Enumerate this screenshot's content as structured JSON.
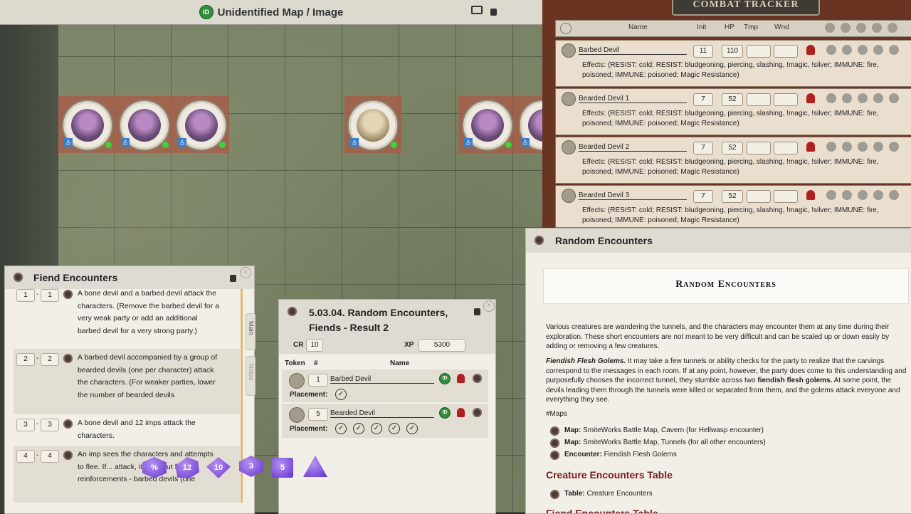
{
  "map": {
    "title": "Unidentified Map / Image",
    "id_badge": "ID"
  },
  "combat_tracker": {
    "title": "COMBAT TRACKER",
    "columns": {
      "name": "Name",
      "init": "Init",
      "hp": "HP",
      "tmp": "Tmp",
      "wnd": "Wnd"
    },
    "rows": [
      {
        "name": "Barbed Devil",
        "init": "11",
        "hp": "110",
        "effects": "Effects: (RESIST: cold; RESIST: bludgeoning, piercing, slashing, !magic, !silver; IMMUNE: fire, poisoned; IMMUNE: poisoned; Magic Resistance)"
      },
      {
        "name": "Bearded Devil 1",
        "init": "7",
        "hp": "52",
        "effects": "Effects: (RESIST: cold; RESIST: bludgeoning, piercing, slashing, !magic, !silver; IMMUNE: fire, poisoned; IMMUNE: poisoned; Magic Resistance)"
      },
      {
        "name": "Bearded Devil 2",
        "init": "7",
        "hp": "52",
        "effects": "Effects: (RESIST: cold; RESIST: bludgeoning, piercing, slashing, !magic, !silver; IMMUNE: fire, poisoned; IMMUNE: poisoned; Magic Resistance)"
      },
      {
        "name": "Bearded Devil 3",
        "init": "7",
        "hp": "52",
        "effects": "Effects: (RESIST: cold; RESIST: bludgeoning, piercing, slashing, !magic, !silver; IMMUNE: fire, poisoned; IMMUNE: poisoned; Magic Resistance)"
      }
    ]
  },
  "fiend_encounters": {
    "title": "Fiend Encounters",
    "side_tabs": [
      "Main",
      "Notes"
    ],
    "rows": [
      {
        "from": "1",
        "to": "1",
        "text": "A bone devil and a barbed devil attack the characters. (Remove the barbed devil for a very weak party or add an additional barbed devil for a very strong party.)"
      },
      {
        "from": "2",
        "to": "2",
        "text": "A barbed devil accompanied by a group of bearded devils (one per character) attack the characters. (For weaker parties, lower the number of bearded devils"
      },
      {
        "from": "3",
        "to": "3",
        "text": "A bone devil and 12 imps attack the characters."
      },
      {
        "from": "4",
        "to": "4",
        "text": "An imp sees the characters and attempts to flee. If... attack, it cries out f... reinforcements - barbed devils (one"
      }
    ]
  },
  "result": {
    "title": "5.03.04. Random Encounters, Fiends - Result 2",
    "cr_label": "CR",
    "cr": "10",
    "xp_label": "XP",
    "xp": "5300",
    "col_token": "Token",
    "col_num": "#",
    "col_name": "Name",
    "placement_label": "Placement:",
    "id_badge": "ID",
    "entries": [
      {
        "count": "1",
        "name": "Barbed Devil",
        "placements": 1
      },
      {
        "count": "5",
        "name": "Bearded Devil",
        "placements": 5
      }
    ]
  },
  "random_encounters": {
    "window_title": "Random Encounters",
    "heading": "Random Encounters",
    "intro": "Various creatures are wandering the tunnels, and the characters may encounter them at any time during their exploration. These short encounters are not meant to be very difficult and can be scaled up or down easily by adding or removing a few creatures.",
    "golem_bold": "Fiendish Flesh Golems.",
    "golem_text_1": " It may take a few tunnels or ability checks for the party to realize that the carvings correspond to the messages in each room. If at any point, however, the party does come to this understanding and purposefully chooses the incorrect tunnel, they stumble across two ",
    "golem_bold_2": "fiendish flesh golems.",
    "golem_text_2": " At some point, the devils leading them through the tunnels were killed or separated from them, and the golems attack everyone and everything they see.",
    "maps_tag": "#Maps",
    "links": [
      {
        "label": "Map:",
        "text": "SmiteWorks Battle Map, Cavern (for Hellwasp encounter)"
      },
      {
        "label": "Map:",
        "text": "SmiteWorks Battle Map, Tunnels (for all other encounters)"
      },
      {
        "label": "Encounter:",
        "text": "Fiendish Flesh Golems"
      }
    ],
    "creature_table_heading": "Creature Encounters Table",
    "table_link": {
      "label": "Table:",
      "text": "Creature Encounters"
    },
    "next_heading_partial": "Fiend Encounters Table"
  },
  "dice": [
    "%",
    "12",
    "10",
    "3",
    "5",
    ""
  ]
}
